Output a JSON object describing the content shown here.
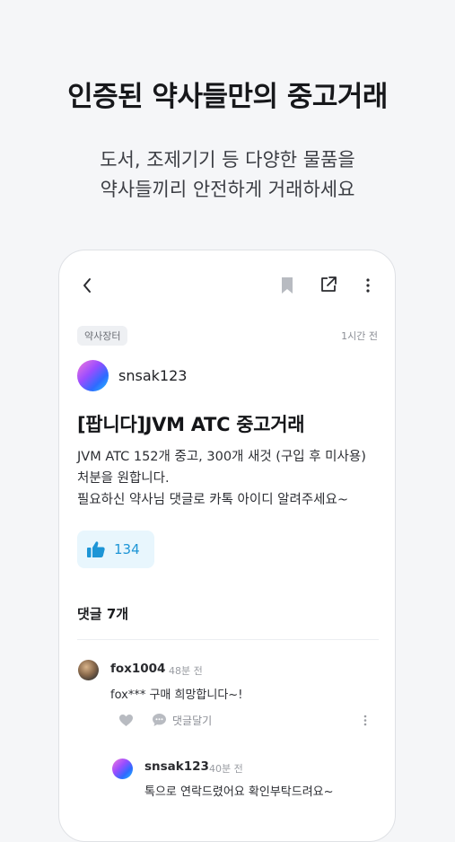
{
  "hero": {
    "title": "인증된 약사들만의 중고거래",
    "subtitle_line1": "도서, 조제기기 등 다양한 물품을",
    "subtitle_line2": "약사들끼리 안전하게 거래하세요"
  },
  "icons": {
    "back": "chevron-left-icon",
    "bookmark": "bookmark-icon",
    "share": "share-icon",
    "more": "more-vertical-icon",
    "like": "thumbs-up-icon",
    "heart": "heart-icon",
    "reply": "speech-bubble-icon"
  },
  "colors": {
    "accent": "#1d95d6",
    "like_bg": "#e8f6fd",
    "icon_gray": "#b8bbc1"
  },
  "post": {
    "category": "약사장터",
    "time": "1시간 전",
    "author": "snsak123",
    "title": "[팝니다]JVM ATC 중고거래",
    "body": [
      "JVM ATC 152개 중고, 300개 새것 (구입 후 미사용)",
      "처분을 원합니다.",
      "필요하신 약사님 댓글로 카톡 아이디 알려주세요~"
    ],
    "likes": "134"
  },
  "comments": {
    "header": "댓글 7개",
    "items": [
      {
        "author": "fox1004",
        "time": "48분 전",
        "text": "fox*** 구매 희망합니다~!",
        "reply_label": "댓글달기"
      },
      {
        "author": "snsak123",
        "time": "40분 전",
        "text": "톡으로 연락드렸어요 확인부탁드려요~"
      }
    ]
  }
}
